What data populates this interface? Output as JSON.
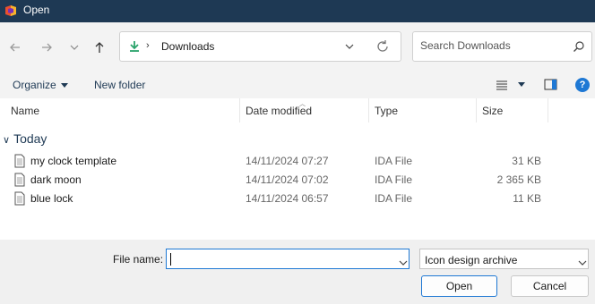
{
  "window": {
    "title": "Open"
  },
  "address": {
    "path": "Downloads",
    "separator": "›"
  },
  "search": {
    "placeholder": "Search Downloads"
  },
  "toolbar": {
    "organize": "Organize",
    "new_folder": "New folder",
    "help": "?"
  },
  "columns": {
    "name": "Name",
    "date": "Date modified",
    "type": "Type",
    "size": "Size"
  },
  "group": {
    "label": "Today"
  },
  "files": [
    {
      "name": "my clock template",
      "date": "14/11/2024 07:27",
      "type": "IDA File",
      "size": "31 KB"
    },
    {
      "name": "dark moon",
      "date": "14/11/2024 07:02",
      "type": "IDA File",
      "size": "2 365 KB"
    },
    {
      "name": "blue lock",
      "date": "14/11/2024 06:57",
      "type": "IDA File",
      "size": "11 KB"
    }
  ],
  "footer": {
    "file_name_label": "File name:",
    "file_name_value": "",
    "file_type": "Icon design archive",
    "open": "Open",
    "cancel": "Cancel"
  },
  "colors": {
    "titlebar": "#1e3954",
    "accent": "#1e78d4",
    "download_icon": "#2aa36b"
  }
}
